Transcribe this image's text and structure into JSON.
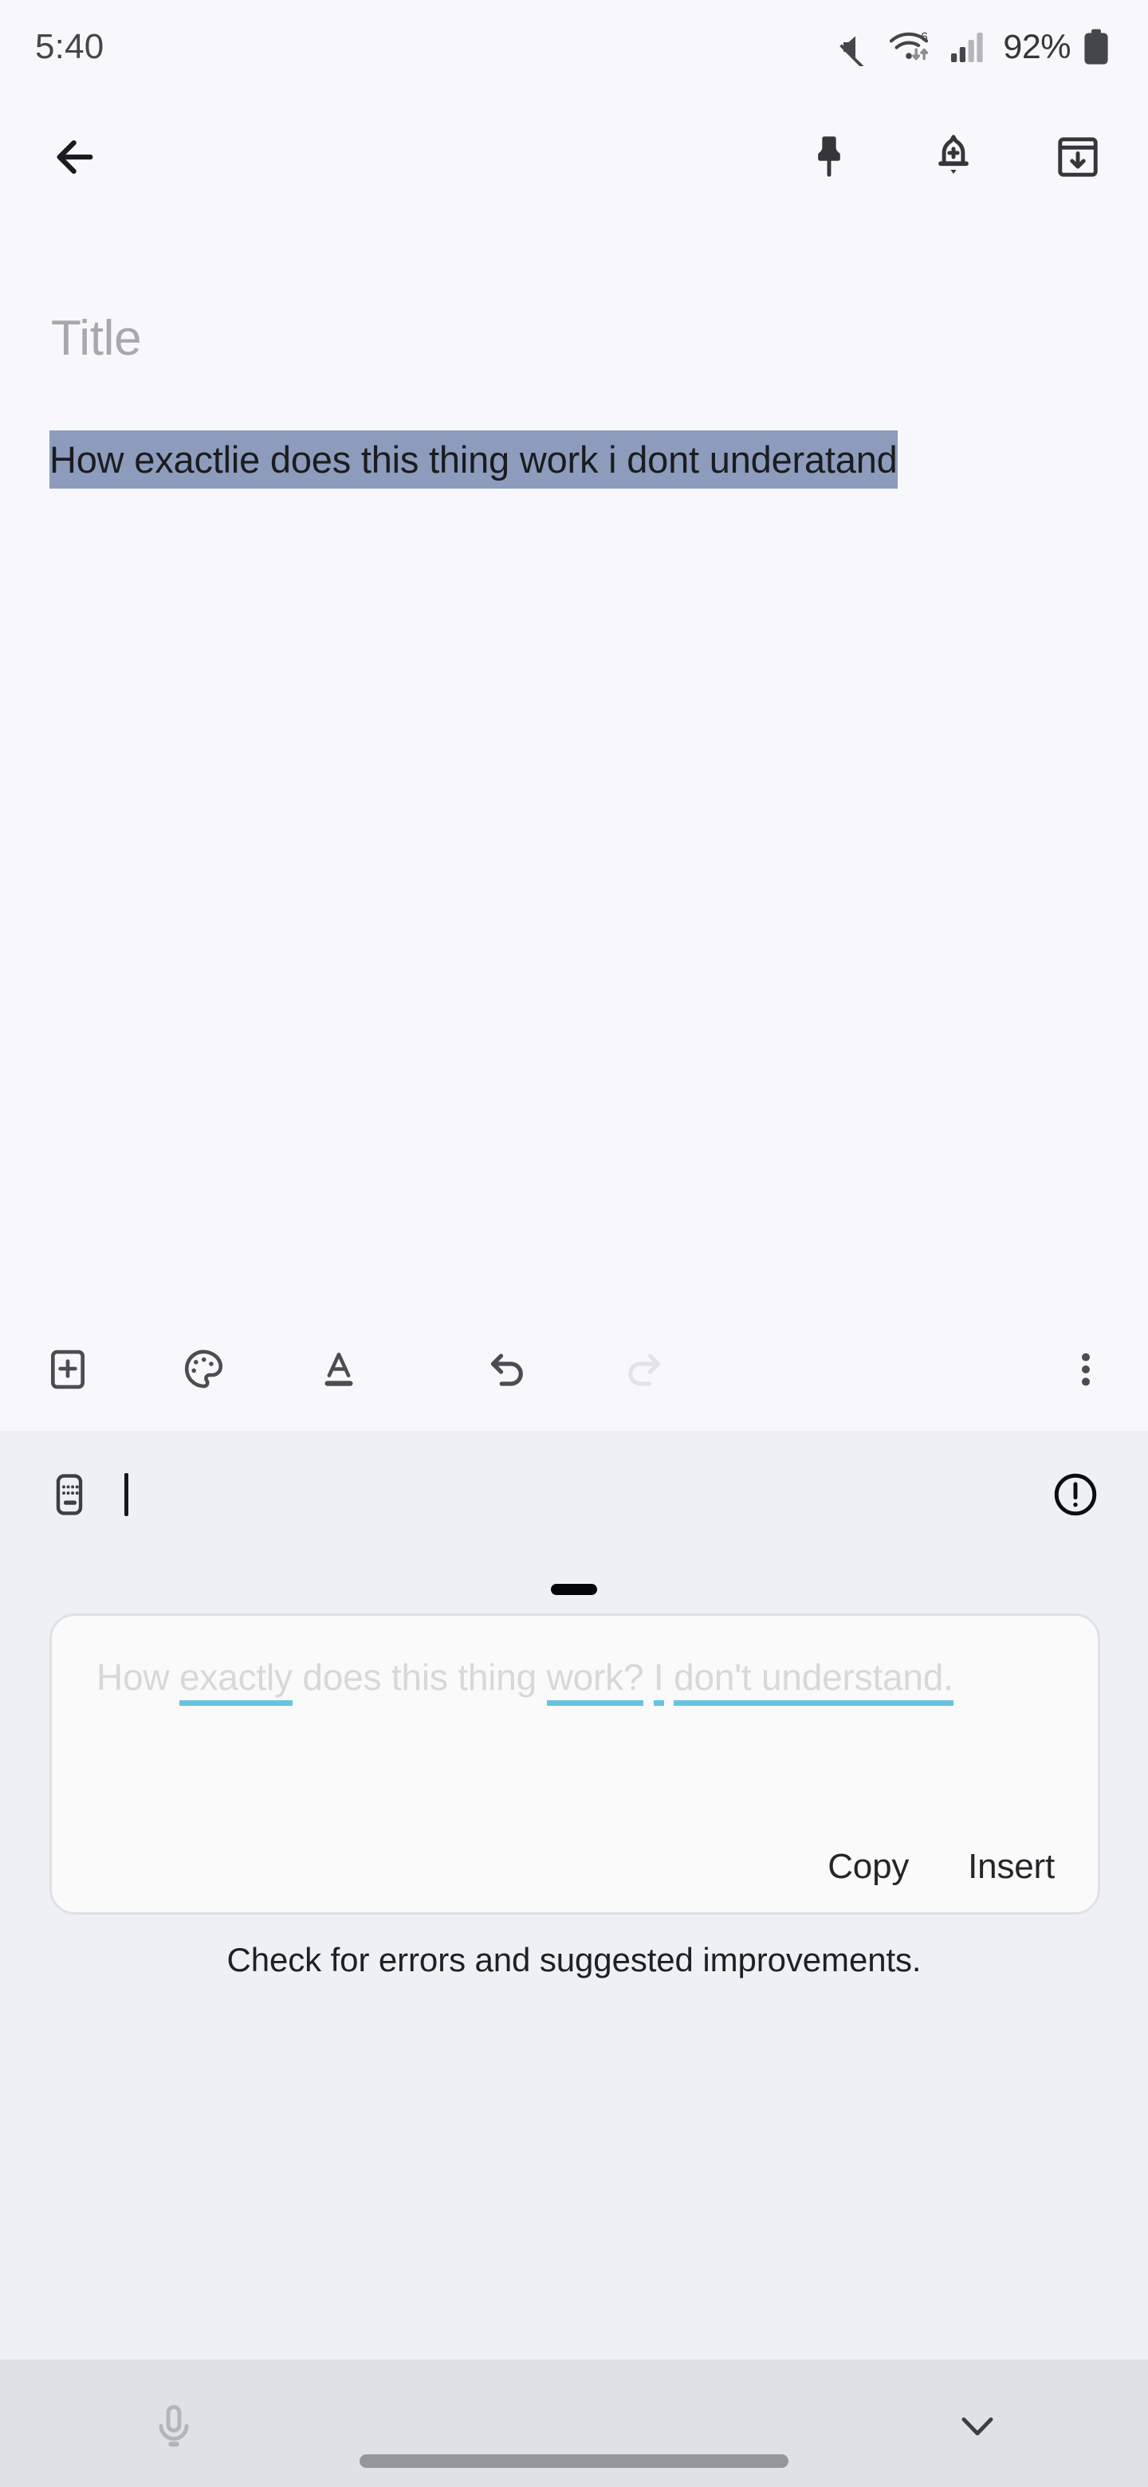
{
  "status_bar": {
    "time": "5:40",
    "battery_percent": "92%",
    "icons": [
      "volume-mute-icon",
      "wifi-6-icon",
      "cellular-signal-icon",
      "battery-icon"
    ],
    "wifi_generation": "6"
  },
  "app_bar": {
    "back_icon": "back-arrow-icon",
    "actions": [
      {
        "icon": "pin-icon",
        "name": "pin-note-button"
      },
      {
        "icon": "add-reminder-icon",
        "name": "add-reminder-button"
      },
      {
        "icon": "archive-icon",
        "name": "archive-note-button"
      }
    ]
  },
  "note": {
    "title_placeholder": "Title",
    "body_text": "How exactlie does this thing work i dont underatand",
    "selection_color": "#8d9cbd"
  },
  "note_toolbar": {
    "items": [
      {
        "icon": "add-box-icon",
        "name": "add-content-button"
      },
      {
        "icon": "palette-icon",
        "name": "background-color-button"
      },
      {
        "icon": "text-format-icon",
        "name": "text-format-button"
      },
      {
        "icon": "undo-icon",
        "name": "undo-button",
        "enabled": true
      },
      {
        "icon": "redo-icon",
        "name": "redo-button",
        "enabled": false
      }
    ],
    "overflow_icon": "more-vert-icon"
  },
  "keyboard_panel": {
    "keyboard_icon": "keyboard-icon",
    "info_icon": "error-circle-icon",
    "drag_handle": "drag-handle",
    "suggestion": {
      "segments": [
        {
          "text": "How ",
          "corrected": false
        },
        {
          "text": "exactly",
          "corrected": true
        },
        {
          "text": " does this thing ",
          "corrected": false
        },
        {
          "text": "work?",
          "corrected": true
        },
        {
          "text": " ",
          "corrected": false
        },
        {
          "text": "I",
          "corrected": true
        },
        {
          "text": " ",
          "corrected": false
        },
        {
          "text": "don't understand.",
          "corrected": true
        }
      ],
      "full_text": "How exactly does this thing work? I don't understand.",
      "underline_color": "#67c3e0",
      "copy_label": "Copy",
      "insert_label": "Insert"
    },
    "hint": "Check for errors and suggested improvements."
  },
  "bottom_bar": {
    "mic_icon": "microphone-icon",
    "dismiss_icon": "chevron-down-icon",
    "home_indicator": "home-indicator"
  }
}
